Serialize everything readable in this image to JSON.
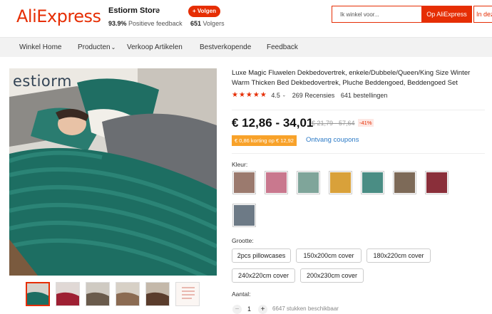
{
  "header": {
    "logo": "AliExpress",
    "store_name": "Estiorm Store",
    "feedback_value": "93.9%",
    "feedback_label": "Positieve feedback",
    "follow_label": "+ Volgen",
    "followers_count": "651",
    "followers_label": "Volgers",
    "search_placeholder": "Ik winkel voor...",
    "search_button": "Op AliExpress",
    "search_button2": "In deze"
  },
  "nav": {
    "items": [
      "Winkel Home",
      "Producten",
      "Verkoop Artikelen",
      "Bestverkopende",
      "Feedback"
    ]
  },
  "gallery": {
    "brand_text": "estiorm"
  },
  "product": {
    "title": "Luxe Magic Fluwelen Dekbedovertrek, enkele/Dubbele/Queen/King Size Winter Warm Thicken Bed Dekbedovertrek, Pluche Beddengoed, Beddengoed Set",
    "stars": "★★★★★",
    "rating": "4.5",
    "reviews": "269 Recensies",
    "orders": "641 bestellingen",
    "price": "€ 12,86 - 34,01",
    "original_price": "€ 21,79 - 57,64",
    "discount": "-41%",
    "coupon_tag": "€ 0,86 korting op € 12,92",
    "coupon_link": "Ontvang coupons",
    "color_label": "Kleur:",
    "size_label": "Grootte:",
    "sizes": [
      "2pcs pillowcases",
      "150x200cm cover",
      "180x220cm cover",
      "240x220cm cover",
      "200x230cm cover"
    ],
    "qty_label": "Aantal:",
    "qty_value": "1",
    "stock": "6647 stukken beschikbaar"
  },
  "colors": {
    "brand": "#e62e04",
    "swatches": [
      "#9b7a6e",
      "#c9788e",
      "#7fa59a",
      "#d9a13a",
      "#4a8d84",
      "#7d6a58",
      "#8a2f3a",
      "#6d7a86"
    ]
  }
}
